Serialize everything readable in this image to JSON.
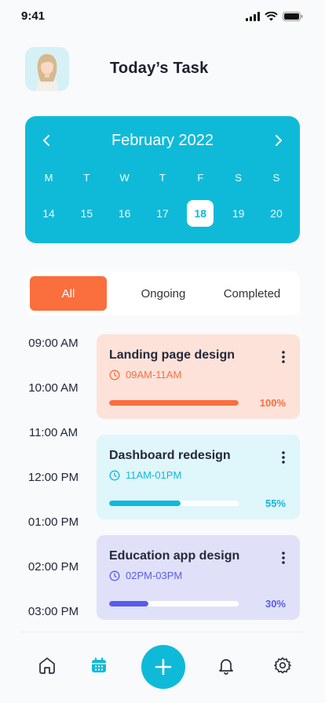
{
  "status_bar": {
    "time": "9:41"
  },
  "header": {
    "title": "Today’s Task"
  },
  "calendar": {
    "month": "February 2022",
    "weekdays": [
      "M",
      "T",
      "W",
      "T",
      "F",
      "S",
      "S"
    ],
    "dates": [
      "14",
      "15",
      "16",
      "17",
      "18",
      "19",
      "20"
    ],
    "selected_date": "18"
  },
  "tabs": [
    {
      "label": "All",
      "active": true
    },
    {
      "label": "Ongoing",
      "active": false
    },
    {
      "label": "Completed",
      "active": false
    }
  ],
  "timeline": [
    "09:00 AM",
    "10:00 AM",
    "11:00 AM",
    "12:00 PM",
    "01:00 PM",
    "02:00 PM",
    "03:00 PM"
  ],
  "tasks": [
    {
      "title": "Landing page design",
      "time": "09AM-11AM",
      "progress": "100%",
      "progress_value": 100,
      "bg": "#fde2d9",
      "accent": "#fb6e3e"
    },
    {
      "title": "Dashboard redesign",
      "time": "11AM-01PM",
      "progress": "55%",
      "progress_value": 55,
      "bg": "#dff6fb",
      "accent": "#0fbad8"
    },
    {
      "title": "Education app design",
      "time": "02PM-03PM",
      "progress": "30%",
      "progress_value": 30,
      "bg": "#e0e1f9",
      "accent": "#5a5de8"
    }
  ],
  "nav": {
    "items": [
      "home-icon",
      "calendar-icon",
      "add-icon",
      "bell-icon",
      "gear-icon"
    ]
  },
  "colors": {
    "primary": "#0fbad8",
    "orange": "#fb6e3e",
    "purple": "#5a5de8"
  }
}
